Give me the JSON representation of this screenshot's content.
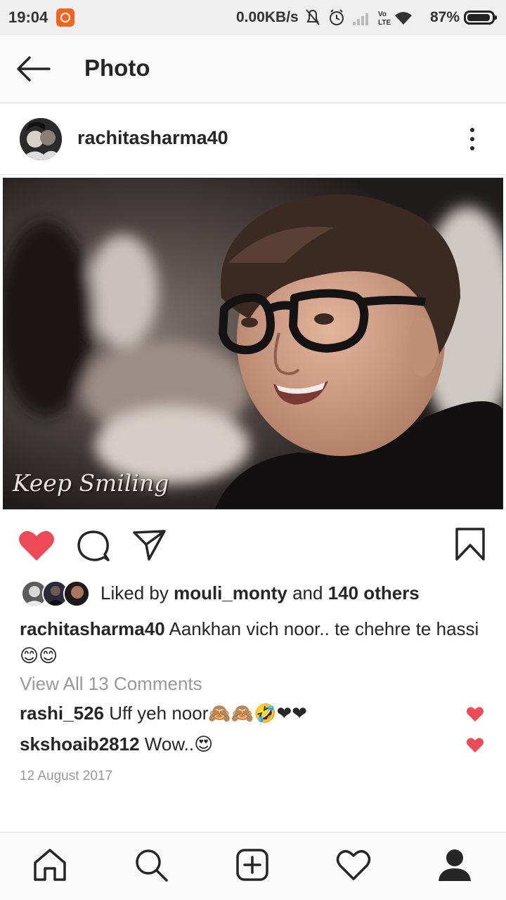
{
  "status_bar": {
    "time": "19:04",
    "net_speed": "0.00KB/s",
    "battery": "87%",
    "icons": [
      "app-notification-icon",
      "mute-bell-icon",
      "alarm-icon",
      "signal-icon",
      "volte-lte-icon",
      "wifi-icon",
      "battery-icon"
    ]
  },
  "header": {
    "title": "Photo",
    "back_icon": "back-arrow-icon"
  },
  "post": {
    "username": "rachitasharma40",
    "photo_overlay_text": "Keep Smiling",
    "likes": {
      "prefix": "Liked by ",
      "liker": "mouli_monty",
      "middle": " and ",
      "others": "140 others"
    },
    "caption": {
      "username": "rachitasharma40",
      "text": " Aankhan vich noor.. te chehre te hassi 😊😊"
    },
    "view_comments": "View All 13 Comments",
    "comments": [
      {
        "username": "rashi_526",
        "text": " Uff yeh noor🙈🙈🤣❤❤"
      },
      {
        "username": "skshoaib2812",
        "text": " Wow..😍"
      }
    ],
    "date": "12 August 2017",
    "liked": true
  },
  "colors": {
    "like_red": "#ed4956",
    "text_primary": "#262626",
    "text_secondary": "#999999",
    "bar_bg": "#fafafa"
  },
  "bottom_nav": [
    "home-icon",
    "search-icon",
    "add-post-icon",
    "activity-heart-icon",
    "profile-icon"
  ]
}
